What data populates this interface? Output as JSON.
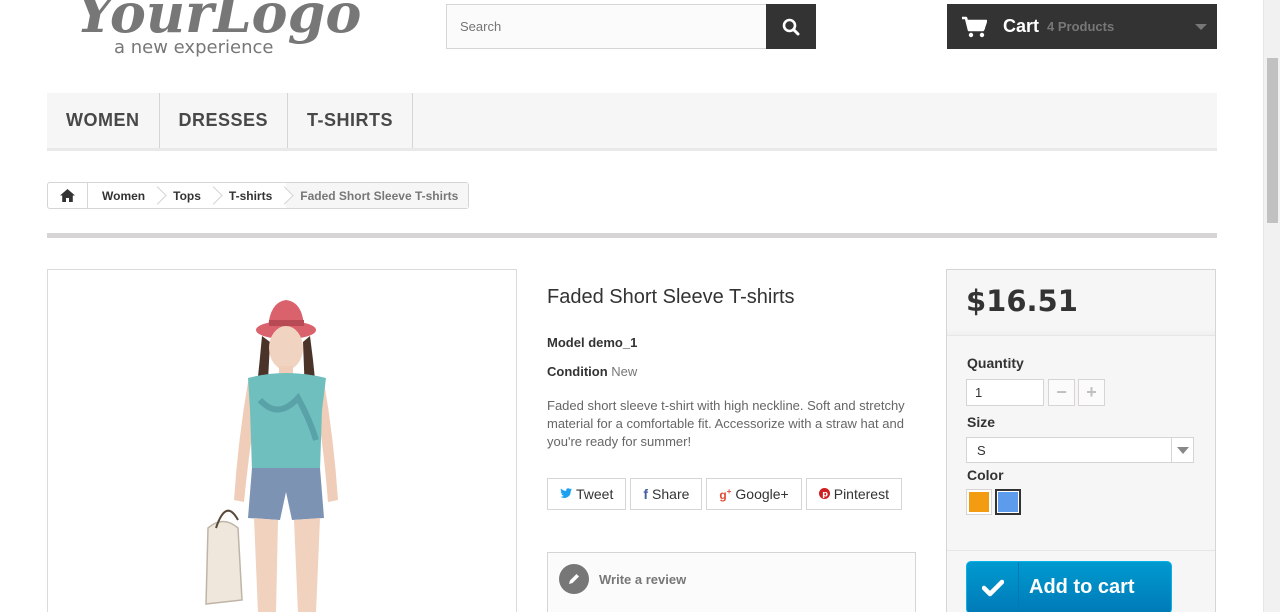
{
  "header": {
    "logo_text": "YourLogo",
    "logo_tagline": "a new experience",
    "search_placeholder": "Search",
    "cart_label": "Cart",
    "cart_count": "4 Products"
  },
  "menu": {
    "items": [
      {
        "label": "WOMEN"
      },
      {
        "label": "DRESSES"
      },
      {
        "label": "T-SHIRTS"
      }
    ]
  },
  "breadcrumb": {
    "items": [
      "Women",
      "Tops",
      "T-shirts",
      "Faded Short Sleeve T-shirts"
    ]
  },
  "product": {
    "title": "Faded Short Sleeve T-shirts",
    "model_label": "Model",
    "model_value": "demo_1",
    "condition_label": "Condition",
    "condition_value": "New",
    "description": "Faded short sleeve t-shirt with high neckline. Soft and stretchy material for a comfortable fit. Accessorize with a straw hat and you're ready for summer!",
    "social": {
      "tweet": "Tweet",
      "share": "Share",
      "googleplus": "Google+",
      "pinterest": "Pinterest"
    },
    "review_label": "Write a review"
  },
  "buy": {
    "price": "$16.51",
    "quantity_label": "Quantity",
    "quantity_value": "1",
    "size_label": "Size",
    "size_value": "S",
    "color_label": "Color",
    "colors": [
      "#f39c11",
      "#5d9cec"
    ],
    "selected_color_index": 1,
    "add_to_cart_label": "Add to cart"
  }
}
